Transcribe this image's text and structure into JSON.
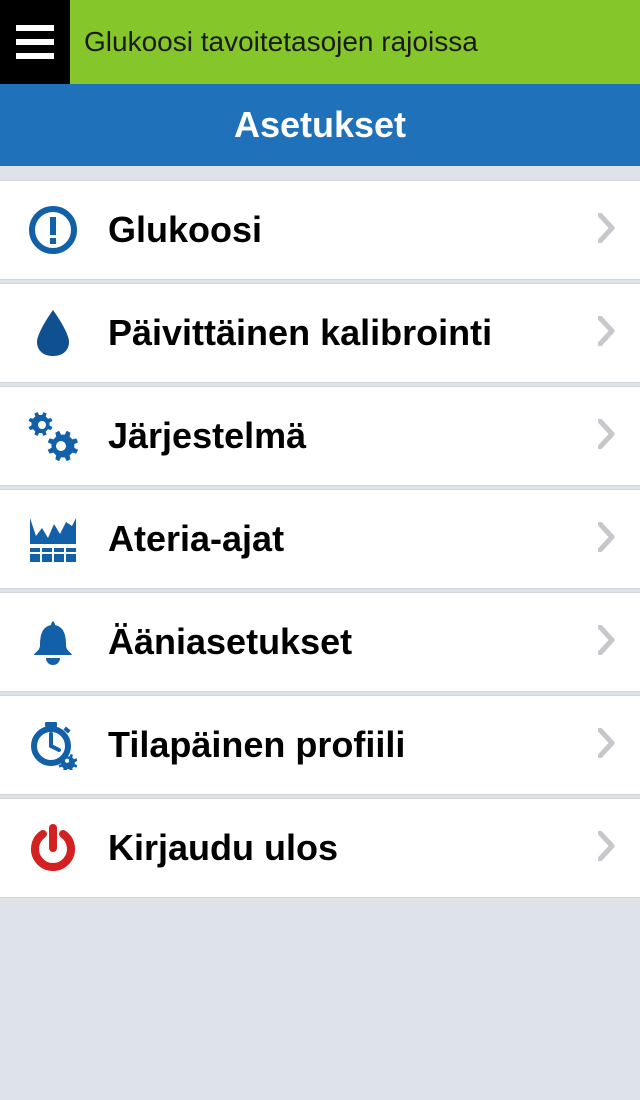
{
  "status_banner": {
    "text": "Glukoosi tavoitetasojen rajoissa"
  },
  "page": {
    "title": "Asetukset"
  },
  "menu": {
    "items": [
      {
        "icon": "alert-icon",
        "label": "Glukoosi"
      },
      {
        "icon": "drop-icon",
        "label": "Päivittäinen kalibrointi"
      },
      {
        "icon": "gears-icon",
        "label": "Järjestelmä"
      },
      {
        "icon": "chart-icon",
        "label": "Ateria-ajat"
      },
      {
        "icon": "bell-icon",
        "label": "Ääniasetukset"
      },
      {
        "icon": "stopwatch-icon",
        "label": "Tilapäinen profiili"
      },
      {
        "icon": "power-icon",
        "label": "Kirjaudu ulos"
      }
    ]
  },
  "colors": {
    "primary_blue": "#1f72b9",
    "icon_blue": "#1260a8",
    "drop_blue": "#0e5090",
    "banner_green": "#85c72a",
    "power_red": "#d32020",
    "chevron_gray": "#c7c7cc"
  }
}
